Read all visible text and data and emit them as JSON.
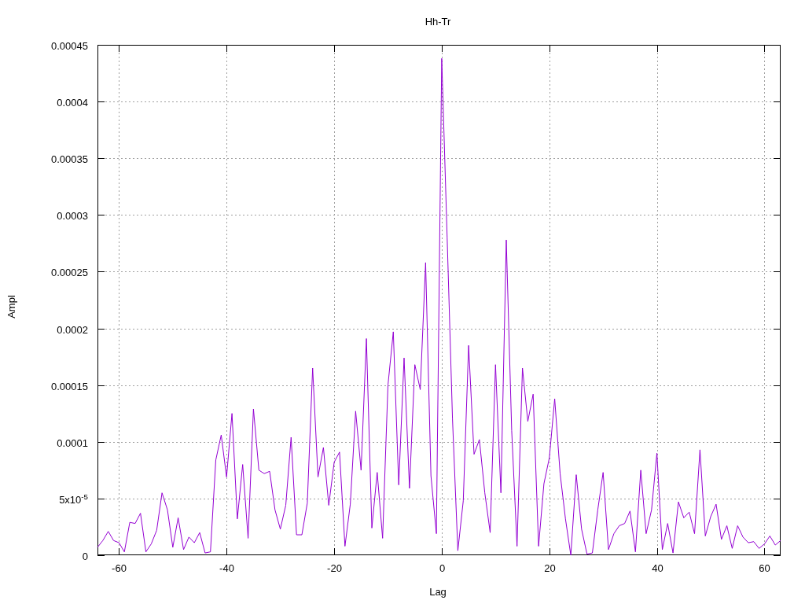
{
  "chart_data": {
    "type": "line",
    "grid": true,
    "title": "Hh-Tr",
    "xlabel": "Lag",
    "ylabel": "Ampl",
    "xlim": [
      -64,
      63
    ],
    "ylim": [
      0,
      0.00045
    ],
    "xticks": [
      -60,
      -40,
      -20,
      0,
      20,
      40,
      60
    ],
    "yticks": [
      0,
      {
        "value": 5e-05,
        "label": "5x10$^{-5}$"
      },
      {
        "value": 0.0001,
        "label": "0.0001"
      },
      {
        "value": 0.00015,
        "label": "0.00015"
      },
      {
        "value": 0.0002,
        "label": "0.0002"
      },
      {
        "value": 0.00025,
        "label": "0.00025"
      },
      {
        "value": 0.0003,
        "label": "0.0003"
      },
      {
        "value": 0.00035,
        "label": "0.00035"
      },
      {
        "value": 0.0004,
        "label": "0.0004"
      },
      {
        "value": 0.00045,
        "label": "0.00045"
      }
    ],
    "x": [
      -64,
      -63,
      -62,
      -61,
      -60,
      -59,
      -58,
      -57,
      -56,
      -55,
      -54,
      -53,
      -52,
      -51,
      -50,
      -49,
      -48,
      -47,
      -46,
      -45,
      -44,
      -43,
      -42,
      -41,
      -40,
      -39,
      -38,
      -37,
      -36,
      -35,
      -34,
      -33,
      -32,
      -31,
      -30,
      -29,
      -28,
      -27,
      -26,
      -25,
      -24,
      -23,
      -22,
      -21,
      -20,
      -19,
      -18,
      -17,
      -16,
      -15,
      -14,
      -13,
      -12,
      -11,
      -10,
      -9,
      -8,
      -7,
      -6,
      -5,
      -4,
      -3,
      -2,
      -1,
      0,
      1,
      2,
      3,
      4,
      5,
      6,
      7,
      8,
      9,
      10,
      11,
      12,
      13,
      14,
      15,
      16,
      17,
      18,
      19,
      20,
      21,
      22,
      23,
      24,
      25,
      26,
      27,
      28,
      29,
      30,
      31,
      32,
      33,
      34,
      35,
      36,
      37,
      38,
      39,
      40,
      41,
      42,
      43,
      44,
      45,
      46,
      47,
      48,
      49,
      50,
      51,
      52,
      53,
      54,
      55,
      56,
      57,
      58,
      59,
      60,
      61,
      62,
      63
    ],
    "series": [
      {
        "color": "#9400d3",
        "values": [
          7e-06,
          1.3e-05,
          2.1e-05,
          1.3e-05,
          1.1e-05,
          3e-06,
          2.9e-05,
          2.8e-05,
          3.7e-05,
          3e-06,
          1e-05,
          2.2e-05,
          5.5e-05,
          4e-05,
          7e-06,
          3.3e-05,
          5e-06,
          1.6e-05,
          1.1e-05,
          2e-05,
          2e-06,
          3e-06,
          8.4e-05,
          0.000106,
          6.9e-05,
          0.000125,
          3.2e-05,
          8e-05,
          1.5e-05,
          0.000129,
          7.5e-05,
          7.2e-05,
          7.4e-05,
          4e-05,
          2.3e-05,
          4.4e-05,
          0.000104,
          1.8e-05,
          1.8e-05,
          4.6e-05,
          0.000165,
          6.9e-05,
          9.5e-05,
          4.4e-05,
          8.2e-05,
          9.1e-05,
          8e-06,
          4.5e-05,
          0.000127,
          7.5e-05,
          0.000191,
          2.4e-05,
          7.3e-05,
          1.5e-05,
          0.00015,
          0.000197,
          6.2e-05,
          0.000174,
          5.9e-05,
          0.000168,
          0.000146,
          0.000258,
          7e-05,
          1.9e-05,
          0.000438,
          0.00028,
          0.00012,
          4e-06,
          4.8e-05,
          0.000185,
          8.9e-05,
          0.000102,
          5.5e-05,
          2e-05,
          0.000168,
          5.5e-05,
          0.000278,
          0.00011,
          8e-06,
          0.000165,
          0.000118,
          0.000142,
          8e-06,
          6.3e-05,
          8.6e-05,
          0.000138,
          7.2e-05,
          3.2e-05,
          0,
          7.1e-05,
          2.3e-05,
          1e-06,
          2e-06,
          4e-05,
          7.3e-05,
          5e-06,
          1.9e-05,
          2.6e-05,
          2.8e-05,
          3.9e-05,
          3e-06,
          7.5e-05,
          1.9e-05,
          4e-05,
          9e-05,
          5e-06,
          2.8e-05,
          2e-06,
          4.7e-05,
          3.3e-05,
          3.8e-05,
          1.9e-05,
          9.3e-05,
          1.7e-05,
          3.4e-05,
          4.5e-05,
          1.4e-05,
          2.6e-05,
          6e-06,
          2.6e-05,
          1.6e-05,
          1.1e-05,
          1.2e-05,
          6e-06,
          1e-05,
          1.7e-05,
          9e-06,
          1.3e-05
        ]
      }
    ]
  }
}
